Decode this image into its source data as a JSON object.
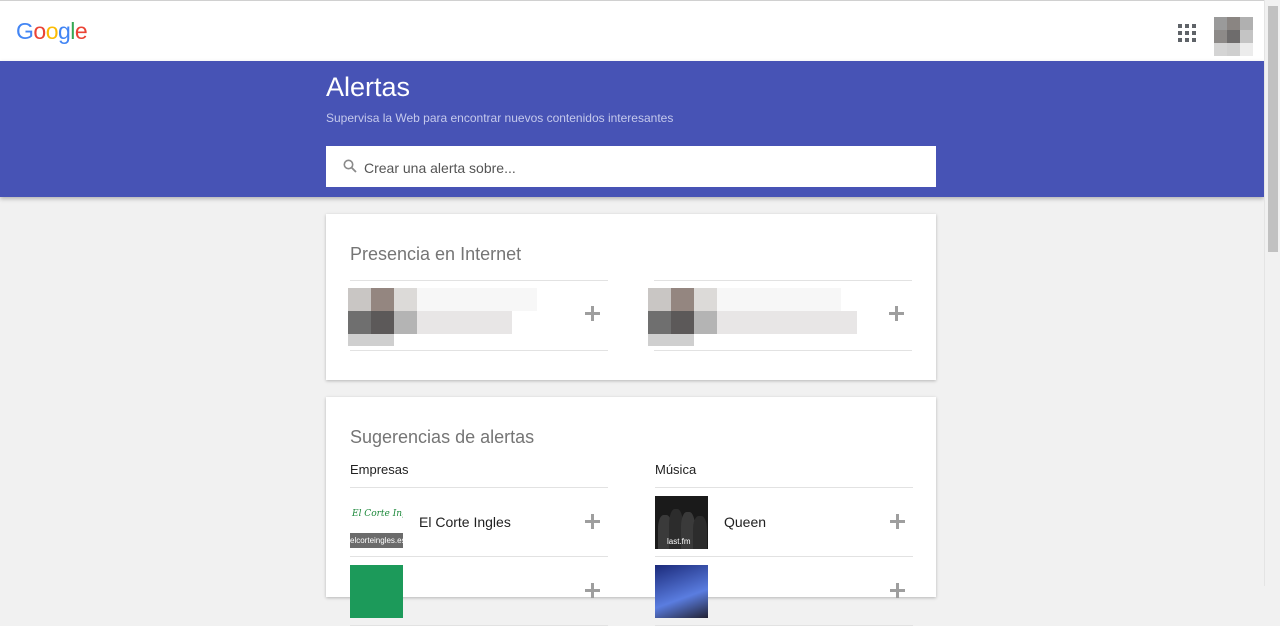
{
  "header": {
    "logo": [
      "G",
      "o",
      "o",
      "g",
      "l",
      "e"
    ],
    "apps_icon": "apps-grid-icon",
    "avatar_icon": "avatar"
  },
  "banner": {
    "title": "Alertas",
    "subtitle": "Supervisa la Web para encontrar nuevos contenidos interesantes",
    "search": {
      "placeholder": "Crear una alerta sobre...",
      "value": ""
    }
  },
  "presence": {
    "title": "Presencia en Internet"
  },
  "suggestions": {
    "title": "Sugerencias de alertas",
    "companies": {
      "heading": "Empresas",
      "items": [
        {
          "label": "El Corte Ingles",
          "thumb_text": "El Corte Inglés",
          "thumb_url": "elcorteingles.es"
        }
      ]
    },
    "music": {
      "heading": "Música",
      "items": [
        {
          "label": "Queen",
          "thumb_caption": "last.fm"
        }
      ]
    }
  },
  "colors": {
    "banner": "#4753b5",
    "page_bg": "#f1f1f1",
    "plus": "#9e9e9e"
  }
}
